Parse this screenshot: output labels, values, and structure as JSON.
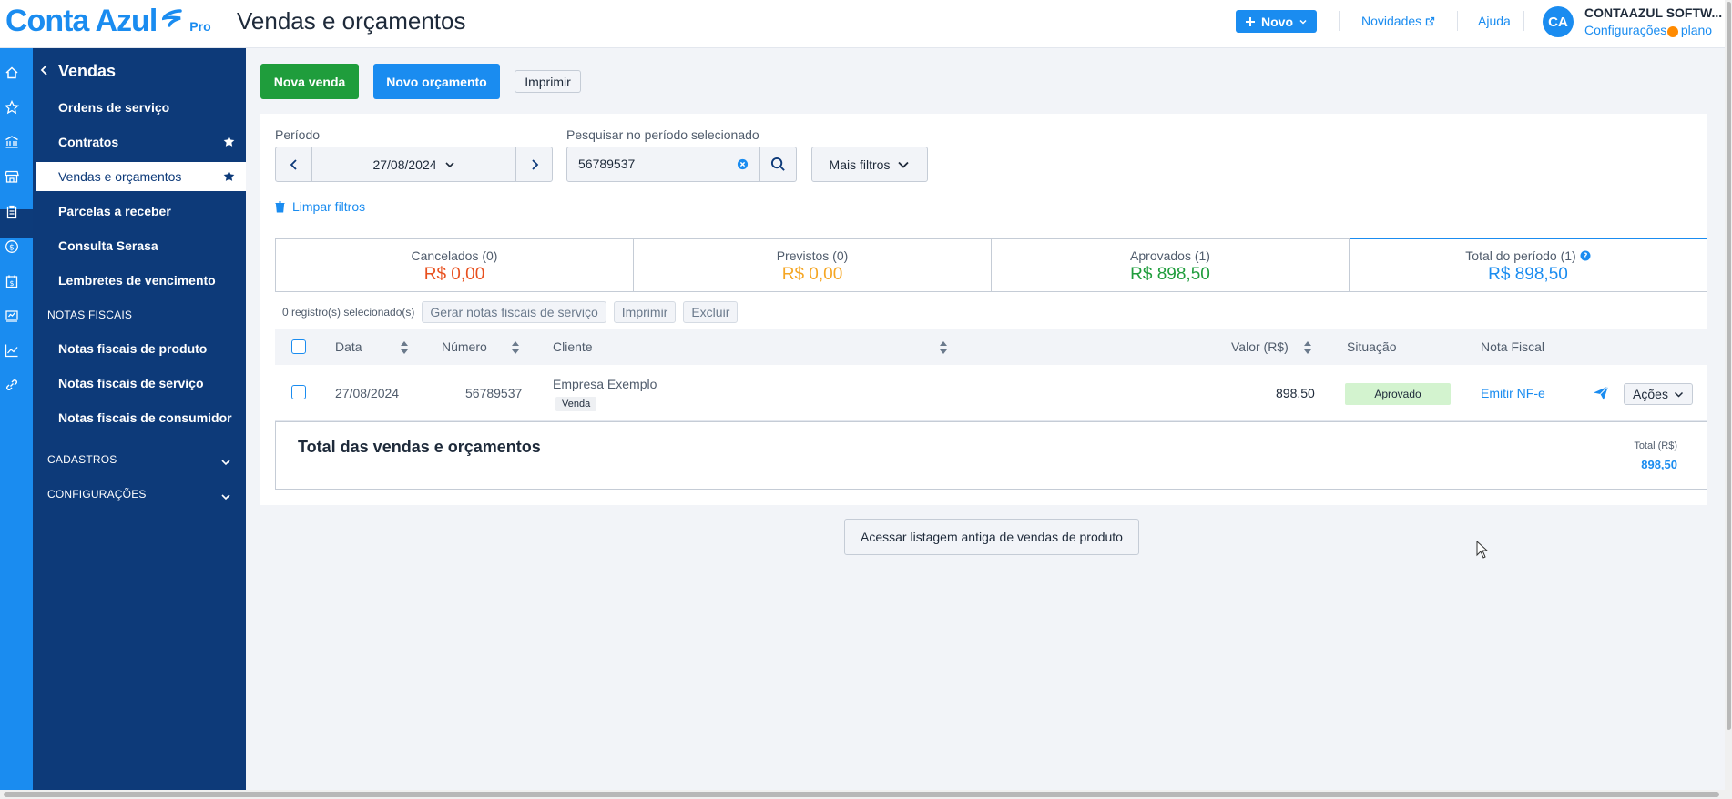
{
  "header": {
    "logo_text": "Conta Azul",
    "logo_plan": "Pro",
    "page_title": "Vendas e orçamentos",
    "novo_label": "Novo",
    "novidades_label": "Novidades",
    "ajuda_label": "Ajuda",
    "avatar_initials": "CA",
    "company_name": "CONTAAZUL SOFTW...",
    "company_link": "Configurações e plano"
  },
  "sidebar": {
    "title": "Vendas",
    "items": [
      {
        "label": "Ordens de serviço"
      },
      {
        "label": "Contratos"
      },
      {
        "label": "Vendas e orçamentos"
      },
      {
        "label": "Parcelas a receber"
      },
      {
        "label": "Consulta Serasa"
      },
      {
        "label": "Lembretes de vencimento"
      }
    ],
    "section_notas": "NOTAS FISCAIS",
    "notas_items": [
      {
        "label": "Notas fiscais de produto"
      },
      {
        "label": "Notas fiscais de serviço"
      },
      {
        "label": "Notas fiscais de consumidor"
      }
    ],
    "section_cadastros": "CADASTROS",
    "section_config": "CONFIGURAÇÕES"
  },
  "actions": {
    "nova_venda": "Nova venda",
    "novo_orcamento": "Novo orçamento",
    "imprimir": "Imprimir"
  },
  "filters": {
    "periodo_label": "Período",
    "periodo_value": "27/08/2024",
    "search_label": "Pesquisar no período selecionado",
    "search_value": "56789537",
    "mais_filtros": "Mais filtros",
    "limpar": "Limpar filtros"
  },
  "summary": [
    {
      "label": "Cancelados (0)",
      "value": "R$ 0,00",
      "color": "#e8501e"
    },
    {
      "label": "Previstos (0)",
      "value": "R$ 0,00",
      "color": "#f5a623"
    },
    {
      "label": "Aprovados (1)",
      "value": "R$ 898,50",
      "color": "#1f9d3c"
    },
    {
      "label": "Total do período (1)",
      "value": "R$ 898,50",
      "color": "#1a8cf0"
    }
  ],
  "bulk": {
    "count": "0 registro(s) selecionado(s)",
    "gerar": "Gerar notas fiscais de serviço",
    "imprimir": "Imprimir",
    "excluir": "Excluir"
  },
  "table": {
    "columns": {
      "data": "Data",
      "numero": "Número",
      "cliente": "Cliente",
      "valor": "Valor (R$)",
      "situacao": "Situação",
      "nota": "Nota Fiscal"
    },
    "rows": [
      {
        "data": "27/08/2024",
        "numero": "56789537",
        "cliente": "Empresa Exemplo",
        "tipo": "Venda",
        "valor": "898,50",
        "situacao": "Aprovado",
        "nota": "Emitir NF-e",
        "acoes": "Ações"
      }
    ]
  },
  "totals": {
    "title": "Total das vendas e orçamentos",
    "label": "Total (R$)",
    "value": "898,50"
  },
  "footer": {
    "antiga": "Acessar listagem antiga de vendas de produto"
  }
}
